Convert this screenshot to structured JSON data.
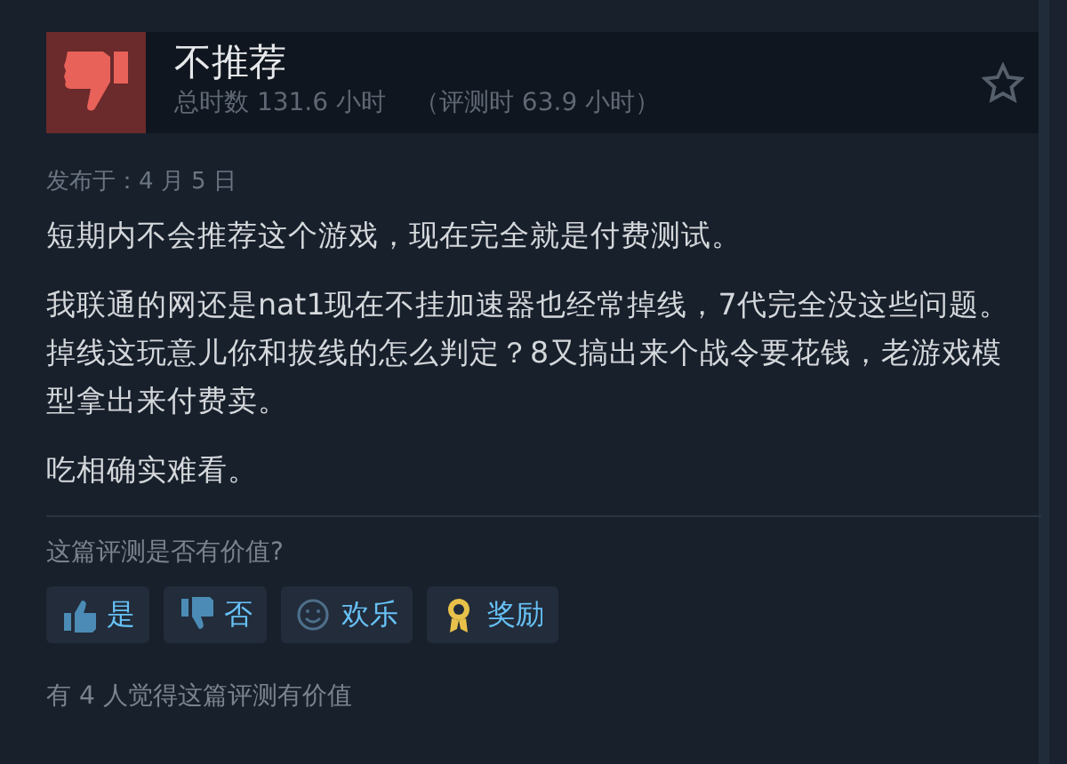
{
  "review": {
    "verdict": "不推荐",
    "hours": "总时数 131.6 小时",
    "review_hours": "（评测时 63.9 小时）",
    "posted": "发布于：4 月 5 日",
    "paragraphs": [
      "短期内不会推荐这个游戏，现在完全就是付费测试。",
      "我联通的网还是nat1现在不挂加速器也经常掉线，7代完全没这些问题。掉线这玩意儿你和拔线的怎么判定？8又搞出来个战令要花钱，老游戏模型拿出来付费卖。",
      "吃相确实难看。"
    ],
    "helpful_prompt": "这篇评测是否有价值?",
    "buttons": [
      {
        "kind": "yes",
        "label": "是"
      },
      {
        "kind": "no",
        "label": "否"
      },
      {
        "kind": "funny",
        "label": "欢乐"
      },
      {
        "kind": "award",
        "label": "奖励"
      }
    ],
    "helpful_count": "有 4 人觉得这篇评测有价值"
  }
}
